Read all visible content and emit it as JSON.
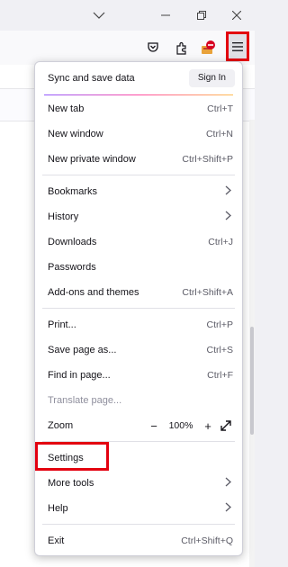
{
  "titlebar": {
    "icons": [
      "chevron-down-icon",
      "minimize-icon",
      "restore-icon",
      "close-icon"
    ]
  },
  "toolbar": {
    "icons": [
      "pocket-icon",
      "extensions-icon",
      "extension-badge-icon",
      "hamburger-menu-icon"
    ]
  },
  "menu": {
    "sync": {
      "label": "Sync and save data",
      "signin": "Sign In"
    },
    "groups": [
      [
        {
          "label": "New tab",
          "shortcut": "Ctrl+T"
        },
        {
          "label": "New window",
          "shortcut": "Ctrl+N"
        },
        {
          "label": "New private window",
          "shortcut": "Ctrl+Shift+P"
        }
      ],
      [
        {
          "label": "Bookmarks",
          "submenu": true
        },
        {
          "label": "History",
          "submenu": true
        },
        {
          "label": "Downloads",
          "shortcut": "Ctrl+J"
        },
        {
          "label": "Passwords"
        },
        {
          "label": "Add-ons and themes",
          "shortcut": "Ctrl+Shift+A"
        }
      ],
      [
        {
          "label": "Print...",
          "shortcut": "Ctrl+P"
        },
        {
          "label": "Save page as...",
          "shortcut": "Ctrl+S"
        },
        {
          "label": "Find in page...",
          "shortcut": "Ctrl+F"
        },
        {
          "label": "Translate page...",
          "disabled": true
        },
        {
          "label": "Zoom",
          "zoom": true
        }
      ],
      [
        {
          "label": "Settings"
        },
        {
          "label": "More tools",
          "submenu": true
        },
        {
          "label": "Help",
          "submenu": true
        }
      ],
      [
        {
          "label": "Exit",
          "shortcut": "Ctrl+Shift+Q"
        }
      ]
    ],
    "zoom": {
      "minus": "−",
      "value": "100%",
      "plus": "+"
    }
  },
  "annotations": {
    "highlight_color": "#e3000f"
  }
}
